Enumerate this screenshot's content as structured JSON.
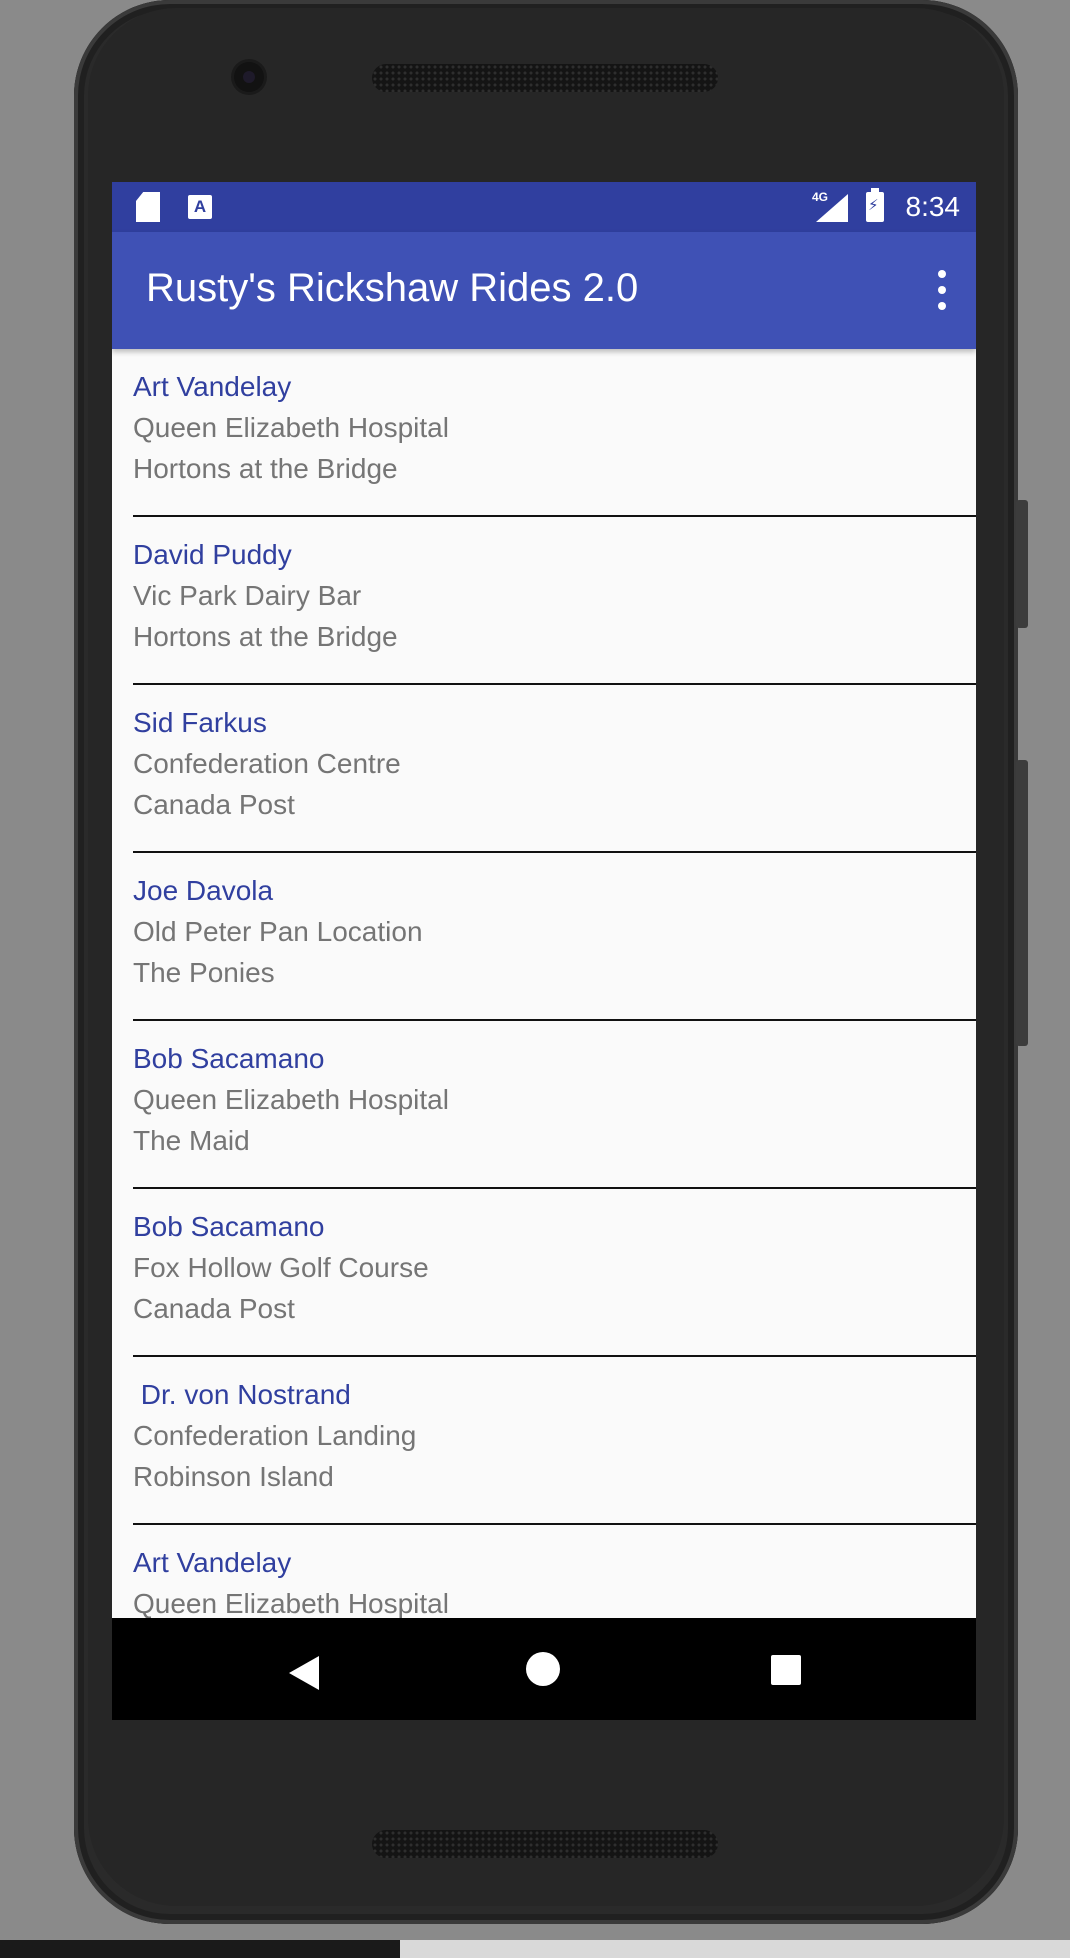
{
  "status_bar": {
    "time": "8:34",
    "network": "4G",
    "notification_icons": [
      "sd-card-icon",
      "keyboard-a-icon"
    ]
  },
  "app_bar": {
    "title": "Rusty's Rickshaw Rides 2.0",
    "overflow_icon": "more-vert-icon"
  },
  "rides": [
    {
      "passenger": "Art Vandelay",
      "pickup": "Queen Elizabeth Hospital",
      "dropoff": "Hortons at the Bridge"
    },
    {
      "passenger": "David Puddy",
      "pickup": "Vic Park Dairy Bar",
      "dropoff": "Hortons at the Bridge"
    },
    {
      "passenger": "Sid Farkus",
      "pickup": "Confederation Centre",
      "dropoff": "Canada Post"
    },
    {
      "passenger": "Joe Davola",
      "pickup": "Old Peter Pan Location",
      "dropoff": "The Ponies"
    },
    {
      "passenger": "Bob Sacamano",
      "pickup": "Queen Elizabeth Hospital",
      "dropoff": "The Maid"
    },
    {
      "passenger": "Bob Sacamano",
      "pickup": "Fox Hollow Golf Course",
      "dropoff": "Canada Post"
    },
    {
      "passenger": " Dr. von Nostrand",
      "pickup": "Confederation Landing",
      "dropoff": "Robinson Island"
    },
    {
      "passenger": "Art Vandelay",
      "pickup": "Queen Elizabeth Hospital",
      "dropoff": ""
    }
  ],
  "nav_bar": {
    "buttons": [
      "back-icon",
      "home-icon",
      "recents-icon"
    ]
  },
  "colors": {
    "status_bar": "#303f9f",
    "app_bar": "#3f51b5",
    "passenger_text": "#303f9f",
    "secondary_text": "#757575",
    "list_background": "#fafafa"
  }
}
